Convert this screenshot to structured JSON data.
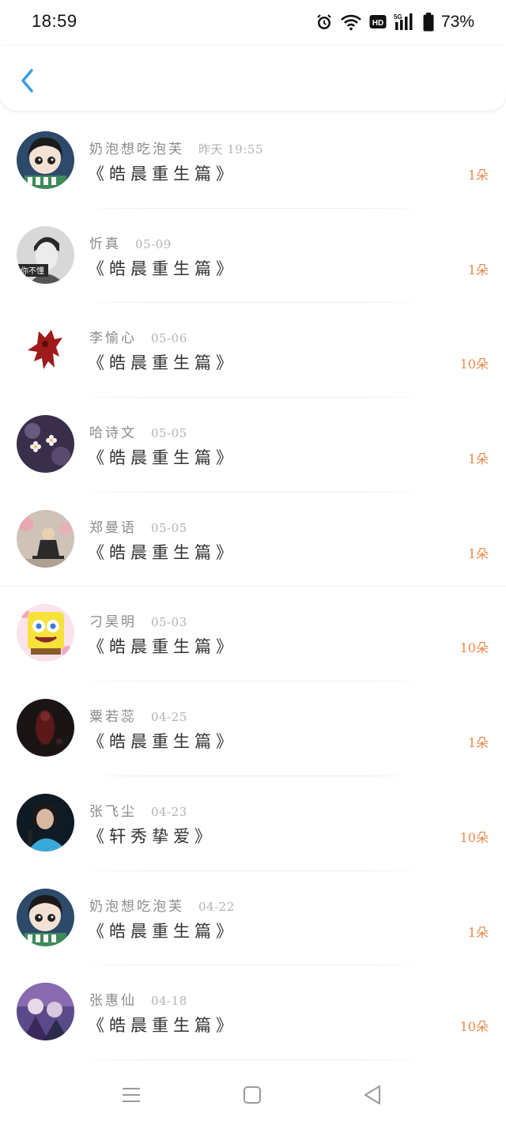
{
  "status": {
    "time": "18:59",
    "battery": "73%",
    "hd_label": "HD",
    "net_label": "5G"
  },
  "colors": {
    "accent": "#3a9de0",
    "count": "#e8894a"
  },
  "icons": {
    "back": "chevron-left-icon",
    "alarm": "alarm-icon",
    "wifi": "wifi-icon",
    "battery": "battery-icon"
  },
  "items": [
    {
      "name": "奶泡想吃泡芙",
      "date": "昨天 19:55",
      "title": "《皓晨重生篇》",
      "count": "1朵"
    },
    {
      "name": "忻真",
      "date": "05-09",
      "title": "《皓晨重生篇》",
      "count": "1朵"
    },
    {
      "name": "李愉心",
      "date": "05-06",
      "title": "《皓晨重生篇》",
      "count": "10朵"
    },
    {
      "name": "哈诗文",
      "date": "05-05",
      "title": "《皓晨重生篇》",
      "count": "1朵"
    },
    {
      "name": "郑曼语",
      "date": "05-05",
      "title": "《皓晨重生篇》",
      "count": "1朵"
    },
    {
      "name": "刁昊明",
      "date": "05-03",
      "title": "《皓晨重生篇》",
      "count": "10朵"
    },
    {
      "name": "粟若蕊",
      "date": "04-25",
      "title": "《皓晨重生篇》",
      "count": "1朵"
    },
    {
      "name": "张飞尘",
      "date": "04-23",
      "title": "《轩秀挚爱》",
      "count": "10朵"
    },
    {
      "name": "奶泡想吃泡芙",
      "date": "04-22",
      "title": "《皓晨重生篇》",
      "count": "1朵"
    },
    {
      "name": "张惠仙",
      "date": "04-18",
      "title": "《皓晨重生篇》",
      "count": "10朵"
    }
  ],
  "avatar_texts": {
    "item_2": "你不懂"
  },
  "navbar": {
    "menu": "menu-icon",
    "home": "home-icon",
    "back": "back-triangle-icon"
  }
}
